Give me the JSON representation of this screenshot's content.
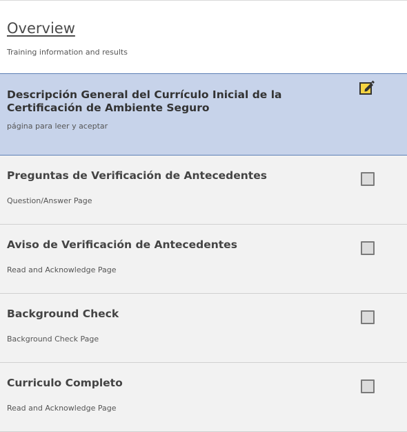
{
  "overview": {
    "title": "Overview",
    "subtitle": "Training information and results"
  },
  "steps": [
    {
      "title": "Descripción General del Currículo Inicial de la Certificación de Ambiente Seguro",
      "subtitle": "página para leer y aceptar",
      "status": "active",
      "icon": "edit-icon"
    },
    {
      "title": "Preguntas de Verificación de Antecedentes",
      "subtitle": "Question/Answer Page",
      "status": "incomplete",
      "icon": "checkbox-icon"
    },
    {
      "title": "Aviso de Verificación de Antecedentes",
      "subtitle": "Read and Acknowledge Page",
      "status": "incomplete",
      "icon": "checkbox-icon"
    },
    {
      "title": "Background Check",
      "subtitle": "Background Check Page",
      "status": "incomplete",
      "icon": "checkbox-icon"
    },
    {
      "title": "Curriculo Completo",
      "subtitle": "Read and Acknowledge Page",
      "status": "incomplete",
      "icon": "checkbox-icon"
    }
  ],
  "colors": {
    "active_bg": "#c7d3ea",
    "item_bg": "#f2f2f2",
    "active_border": "#5b7fb5",
    "edit_icon_fill": "#f5d442"
  }
}
